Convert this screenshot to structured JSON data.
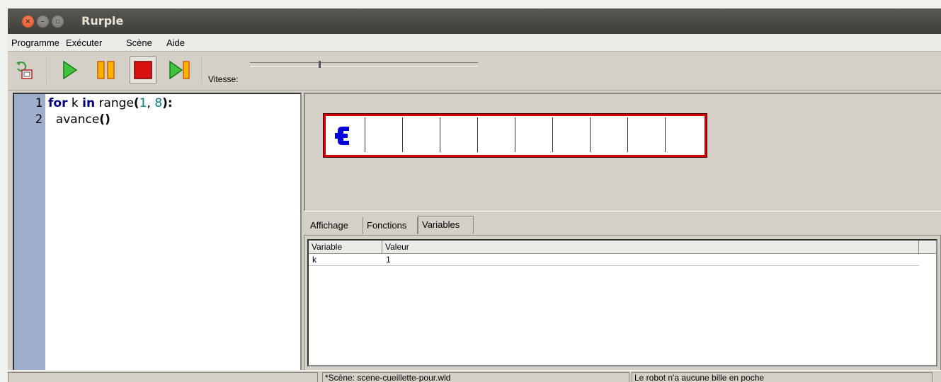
{
  "window": {
    "title": "Rurple"
  },
  "menu": {
    "items": [
      "Programme",
      "Exécuter",
      "Scène",
      "Aide"
    ]
  },
  "toolbar": {
    "speed_label": "Vitesse:",
    "buttons": [
      "reload-world-icon",
      "play-icon",
      "pause-icon",
      "stop-icon",
      "step-icon"
    ],
    "speed_level": 0.3
  },
  "editor": {
    "line_numbers": [
      "1",
      "2"
    ],
    "line1": {
      "kw_for": "for",
      "var": " k ",
      "kw_in": "in",
      "fn": " range",
      "open": "(",
      "n1": "1",
      "comma": ", ",
      "n2": "8",
      "close": "):"
    },
    "line2": {
      "indent": "  avance",
      "parens": "()"
    }
  },
  "world": {
    "cells": 10,
    "robot_position": 1
  },
  "tabs": {
    "items": [
      "Affichage",
      "Fonctions",
      "Variables"
    ],
    "active": "Variables"
  },
  "variables": {
    "headers": [
      "Variable",
      "Valeur"
    ],
    "rows": [
      {
        "name": "k",
        "value": "1"
      }
    ]
  },
  "status": {
    "scene": "*Scène: scene-cueillette-pour.wld",
    "robot": "Le robot n'a aucune bille en poche"
  },
  "colors": {
    "titlebar": "#3e3d39",
    "wall": "#d00000",
    "gutter": "#9dadcc",
    "keyword": "#00007f",
    "number": "#008080"
  }
}
